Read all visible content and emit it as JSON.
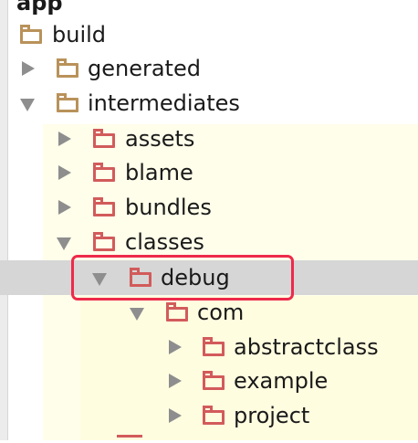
{
  "tree": {
    "root_label": "app",
    "rows": [
      {
        "label": "build",
        "state": "none",
        "color": "brown"
      },
      {
        "label": "generated",
        "state": "collapsed",
        "color": "brown"
      },
      {
        "label": "intermediates",
        "state": "expanded",
        "color": "brown"
      },
      {
        "label": "assets",
        "state": "collapsed",
        "color": "red"
      },
      {
        "label": "blame",
        "state": "collapsed",
        "color": "red"
      },
      {
        "label": "bundles",
        "state": "collapsed",
        "color": "red"
      },
      {
        "label": "classes",
        "state": "expanded",
        "color": "red"
      },
      {
        "label": "debug",
        "state": "expanded",
        "color": "red",
        "selected": true,
        "highlighted": true
      },
      {
        "label": "com",
        "state": "expanded",
        "color": "red"
      },
      {
        "label": "abstractclass",
        "state": "collapsed",
        "color": "red"
      },
      {
        "label": "example",
        "state": "collapsed",
        "color": "red"
      },
      {
        "label": "project",
        "state": "collapsed",
        "color": "red"
      }
    ]
  },
  "colors": {
    "folder_brown": "#b9925a",
    "folder_red": "#d25b5b",
    "selection_bg": "#d6d6d6",
    "highlight_border": "#ee2a4a",
    "tree_bg": "#fffeea"
  }
}
